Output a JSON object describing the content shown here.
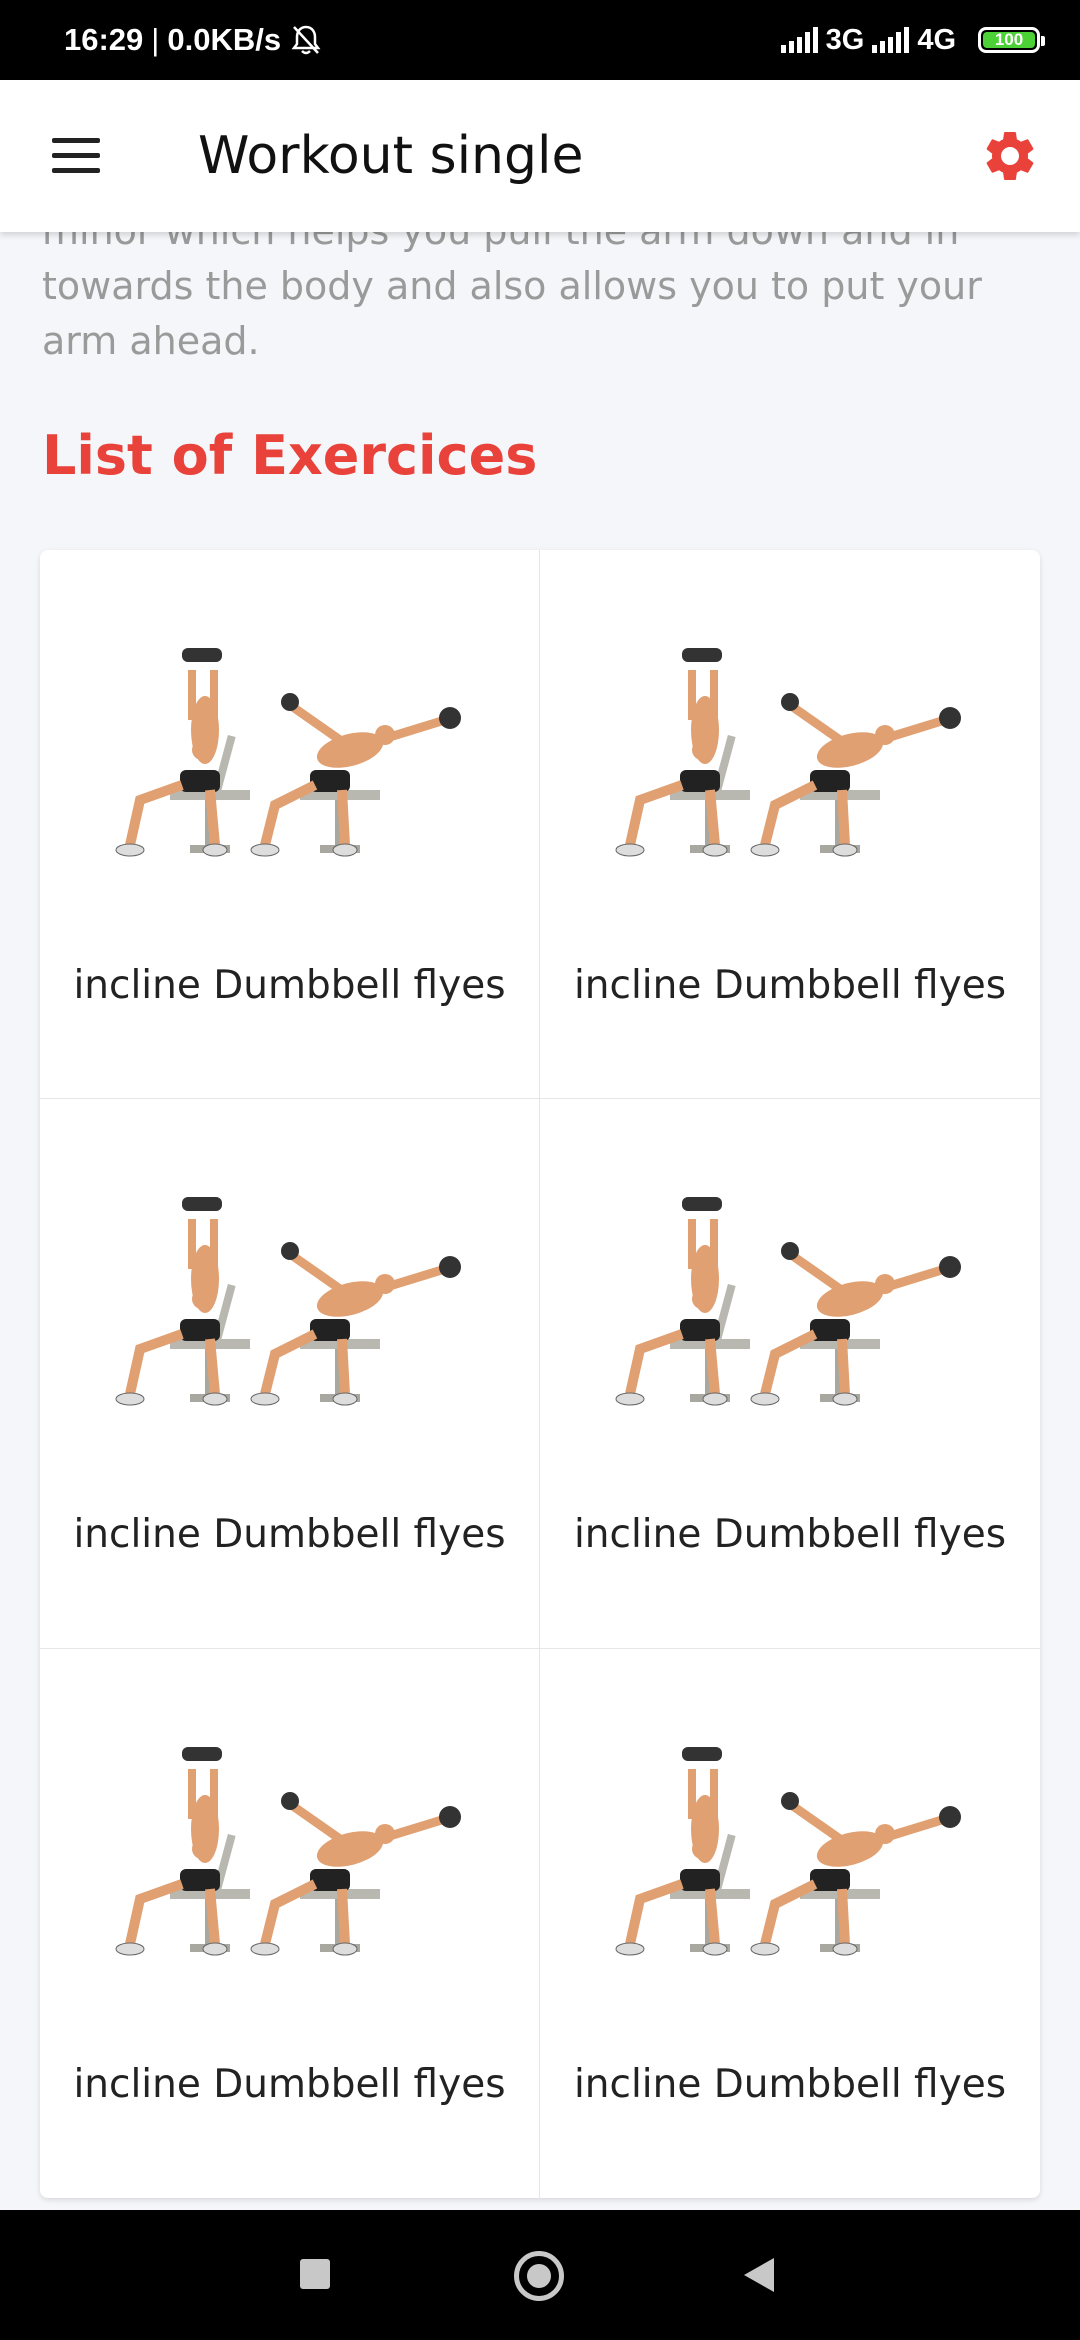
{
  "status_bar": {
    "time": "16:29",
    "net_speed": "0.0KB/s",
    "network_1": "3G",
    "network_2": "4G",
    "battery": "100"
  },
  "app_bar": {
    "title": "Workout single",
    "menu_icon": "hamburger-menu-icon",
    "settings_icon": "gear-icon",
    "accent_color": "#e8423a"
  },
  "description": "minor which helps you pull the arm down and in towards the body and also allows you to put your arm ahead.",
  "section_title": "List of Exercices",
  "exercises": [
    {
      "label": "incline Dumbbell flyes"
    },
    {
      "label": "incline Dumbbell flyes"
    },
    {
      "label": "incline Dumbbell flyes"
    },
    {
      "label": "incline Dumbbell flyes"
    },
    {
      "label": "incline Dumbbell flyes"
    },
    {
      "label": "incline Dumbbell flyes"
    }
  ],
  "nav_bar": {
    "recents_icon": "square-icon",
    "home_icon": "circle-icon",
    "back_icon": "triangle-back-icon"
  }
}
